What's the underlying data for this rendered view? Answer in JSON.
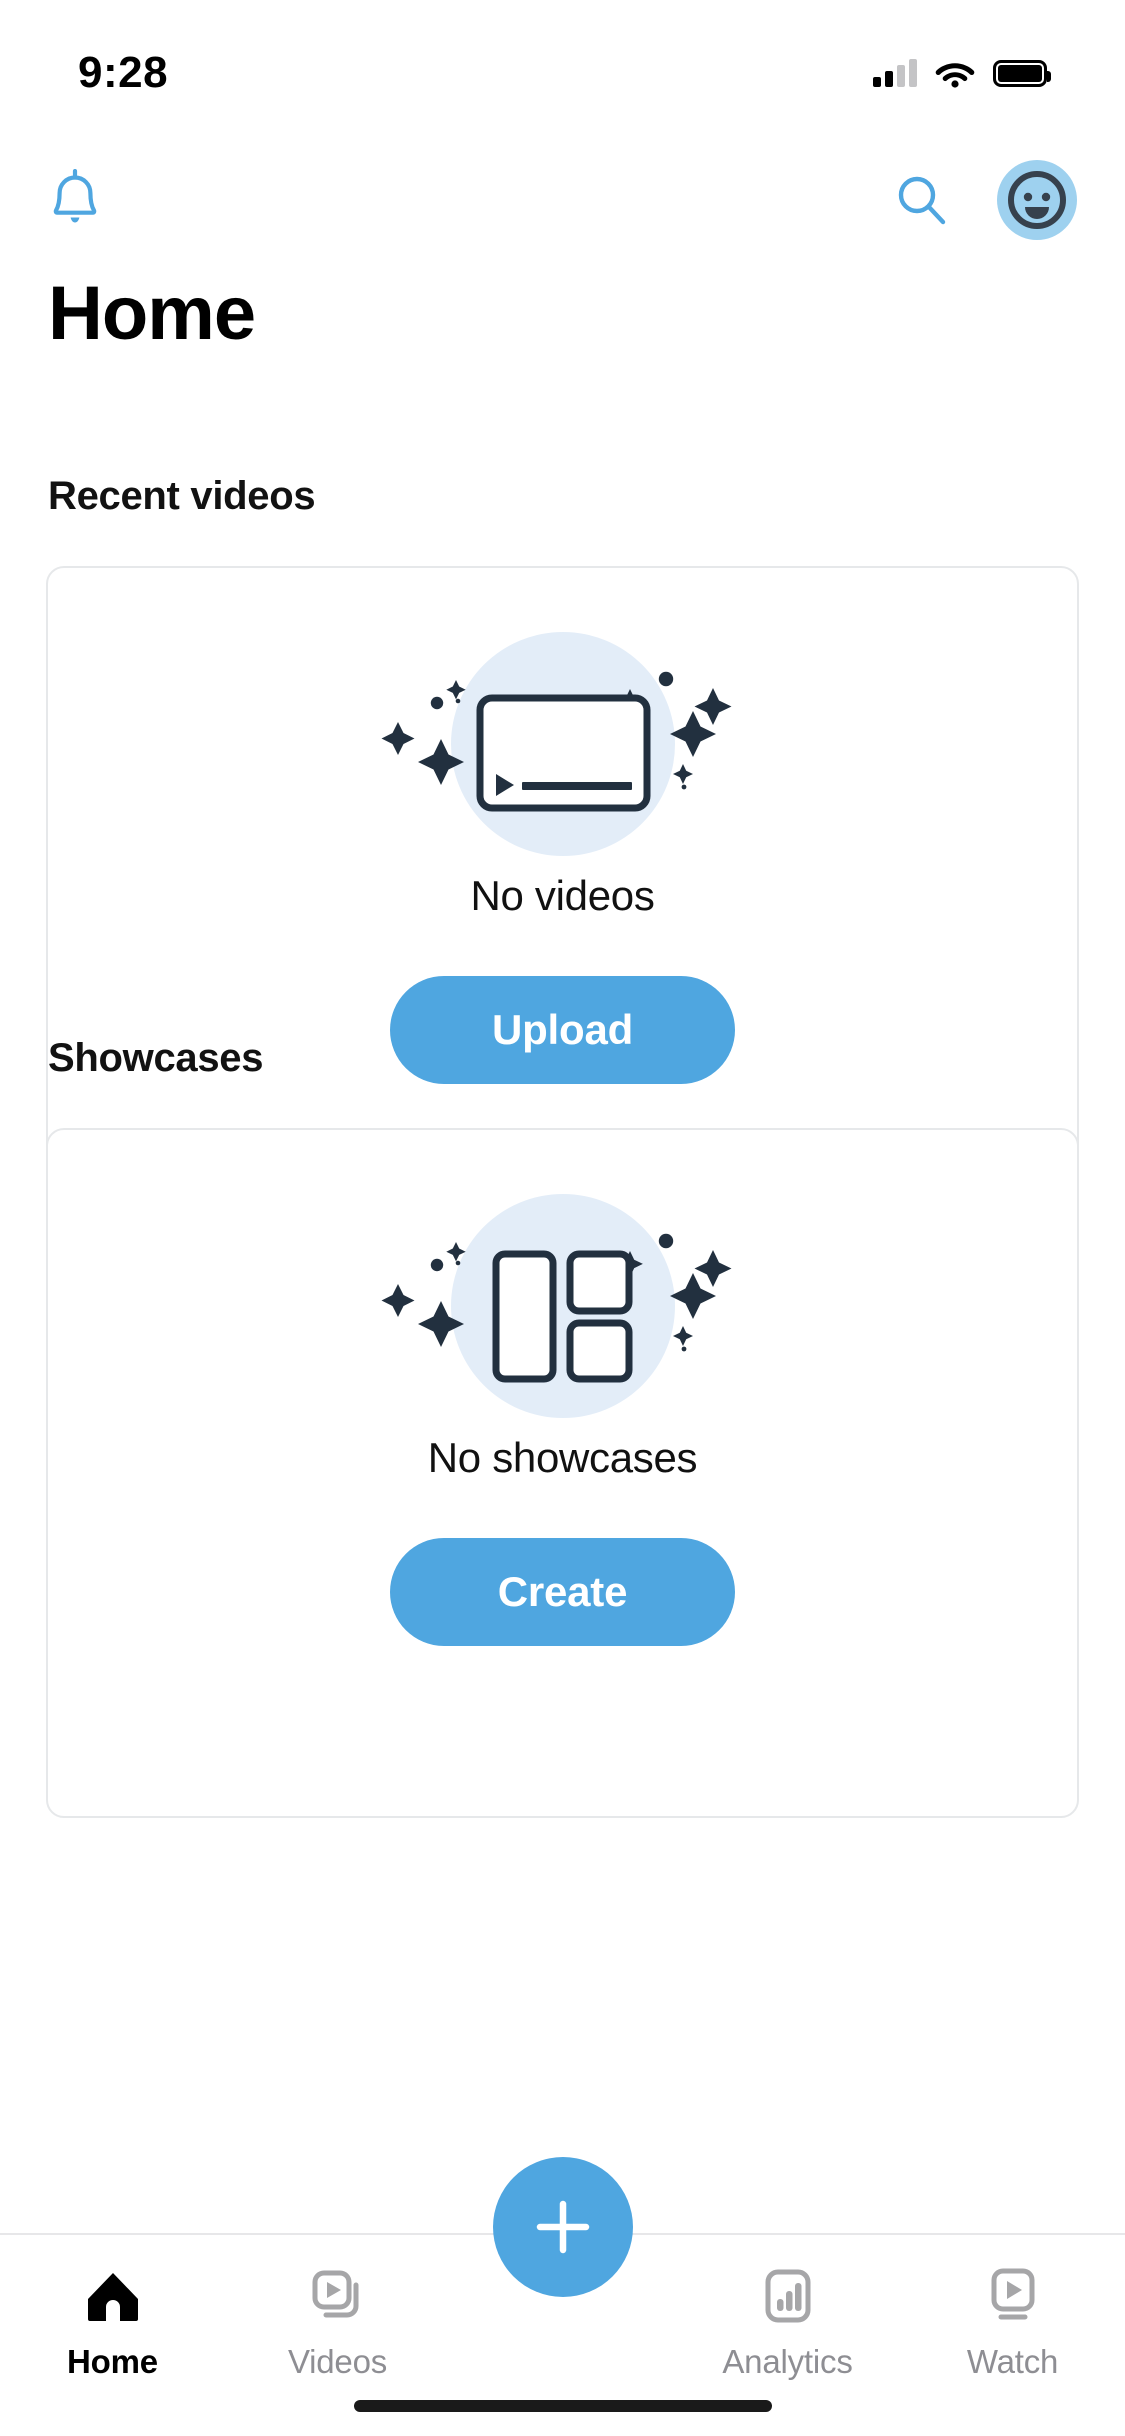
{
  "status_bar": {
    "time": "9:28",
    "signal_icon": "cellular-signal-icon",
    "wifi_icon": "wifi-icon",
    "battery_icon": "battery-full-icon",
    "signal_bars_filled": 2,
    "signal_bars_total": 4
  },
  "header": {
    "notifications_icon": "bell-icon",
    "search_icon": "search-icon",
    "avatar_icon": "avatar-smiley-icon",
    "accent_color": "#4fa6e0",
    "avatar_bg_color": "#9ed1ef"
  },
  "page": {
    "title": "Home"
  },
  "sections": [
    {
      "title": "Recent videos",
      "illustration_icon": "empty-video-player-icon",
      "empty_text": "No videos",
      "action_label": "Upload",
      "action_name": "upload-button"
    },
    {
      "title": "Showcases",
      "illustration_icon": "empty-showcase-grid-icon",
      "empty_text": "No showcases",
      "action_label": "Create",
      "action_name": "create-button"
    }
  ],
  "illustration_colors": {
    "circle": "#e3edf8",
    "stroke": "#22303f"
  },
  "tabbar": {
    "items": [
      {
        "label": "Home",
        "icon": "home-icon",
        "active": true
      },
      {
        "label": "Videos",
        "icon": "videos-icon",
        "active": false
      },
      {
        "label": "",
        "icon": "",
        "active": false
      },
      {
        "label": "Analytics",
        "icon": "analytics-icon",
        "active": false
      },
      {
        "label": "Watch",
        "icon": "watch-icon",
        "active": false
      }
    ],
    "fab_icon": "plus-icon",
    "fab_color": "#4fa6e0",
    "inactive_color": "#8e8e93",
    "active_color": "#000000"
  }
}
